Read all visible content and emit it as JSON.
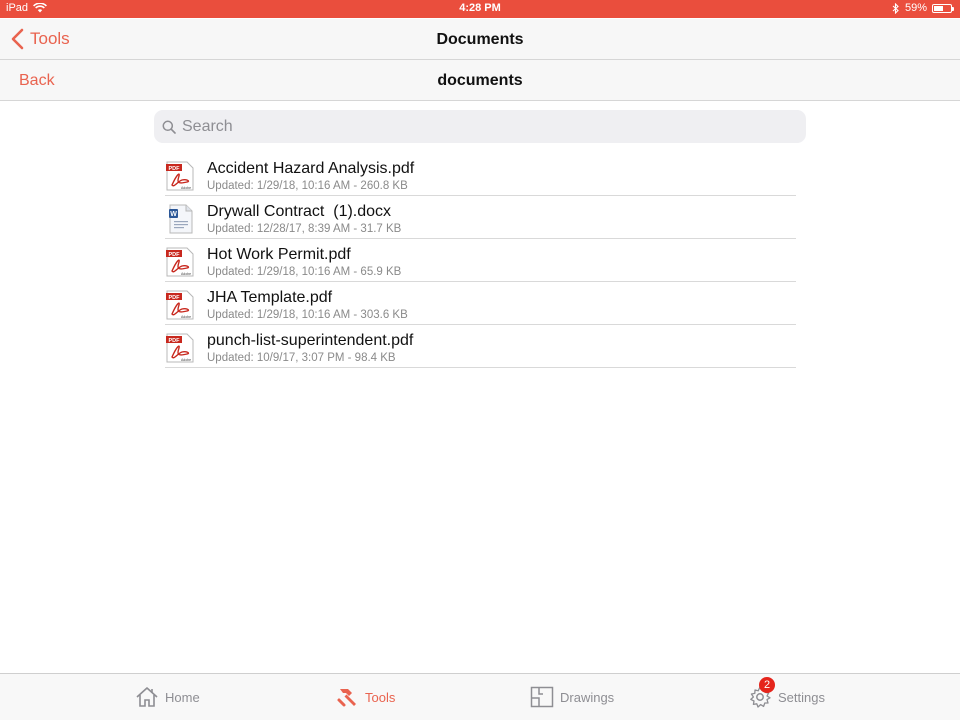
{
  "status_bar": {
    "device": "iPad",
    "time": "4:28 PM",
    "battery": "59%",
    "battery_level": 0.59
  },
  "nav": {
    "back_label": "Tools",
    "title": "Documents"
  },
  "subnav": {
    "back_label": "Back",
    "title": "documents"
  },
  "search": {
    "placeholder": "Search",
    "value": ""
  },
  "files": [
    {
      "name": "Accident Hazard Analysis.pdf",
      "meta": "Updated: 1/29/18, 10:16 AM - 260.8 KB",
      "type": "pdf"
    },
    {
      "name": "Drywall Contract  (1).docx",
      "meta": "Updated: 12/28/17, 8:39 AM - 31.7 KB",
      "type": "docx"
    },
    {
      "name": "Hot Work Permit.pdf",
      "meta": "Updated: 1/29/18, 10:16 AM - 65.9 KB",
      "type": "pdf"
    },
    {
      "name": "JHA Template.pdf",
      "meta": "Updated: 1/29/18, 10:16 AM - 303.6 KB",
      "type": "pdf"
    },
    {
      "name": "punch-list-superintendent.pdf",
      "meta": "Updated: 10/9/17, 3:07 PM - 98.4 KB",
      "type": "pdf"
    }
  ],
  "icons": {
    "pdf": "pdf-file-icon",
    "docx": "word-file-icon"
  },
  "tab_bar": {
    "home": "Home",
    "tools": "Tools",
    "drawings": "Drawings",
    "settings": "Settings",
    "settings_badge": "2"
  },
  "colors": {
    "accent": "#e9634f",
    "status_bar": "#ea4e3d",
    "badge": "#e5251c"
  }
}
